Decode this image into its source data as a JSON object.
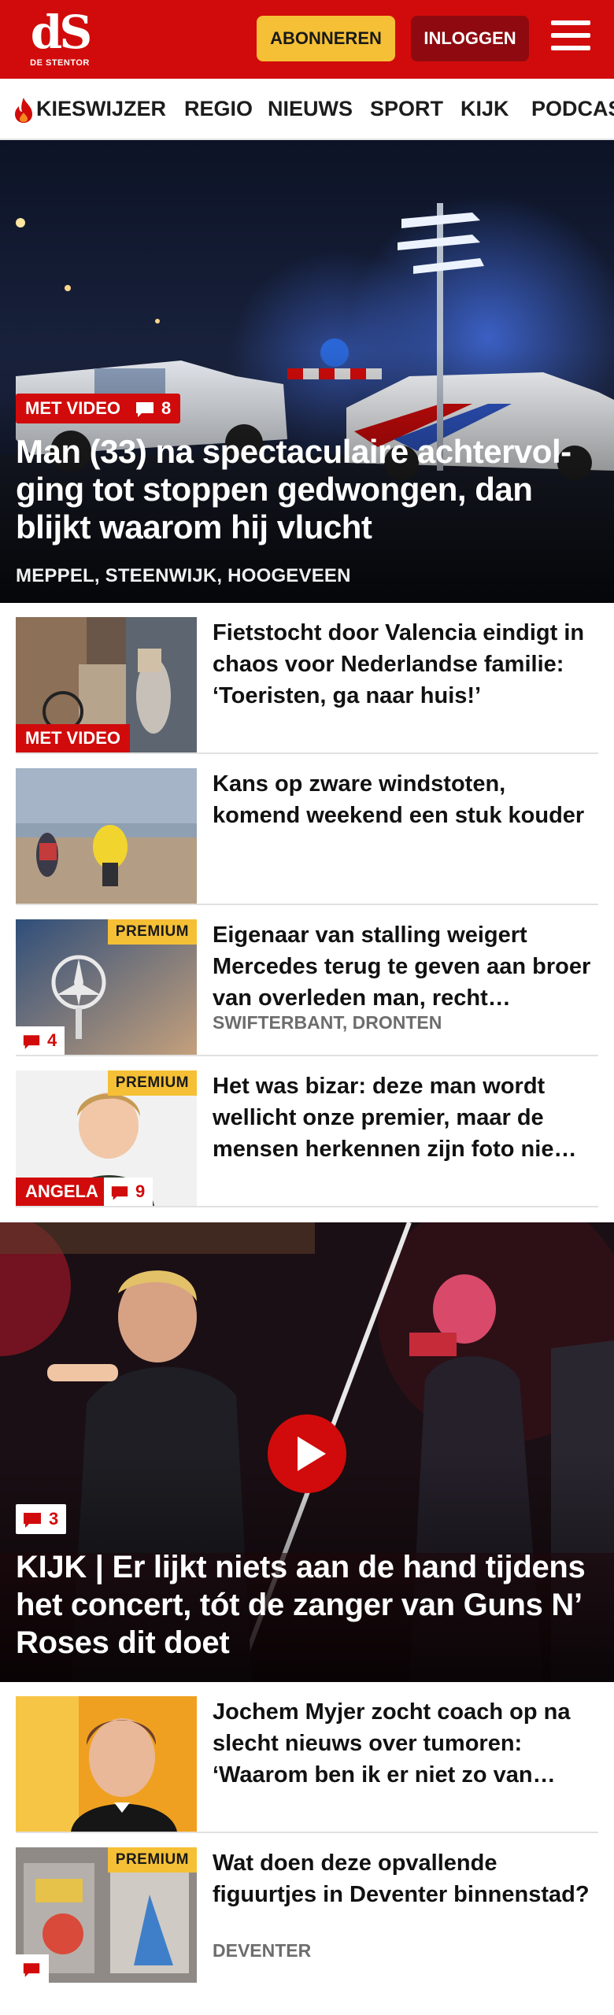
{
  "header": {
    "logo_mark": "dS",
    "logo_sub": "DE STENTOR",
    "subscribe_label": "ABONNEREN",
    "login_label": "INLOGGEN",
    "brand_red": "#d10b0b",
    "subscribe_yellow": "#f5c035"
  },
  "nav": {
    "items": [
      {
        "label": "KIESWIJZER",
        "icon": "flame-icon"
      },
      {
        "label": "REGIO"
      },
      {
        "label": "NIEUWS"
      },
      {
        "label": "SPORT"
      },
      {
        "label": "KIJK"
      },
      {
        "label": "PODCAS"
      }
    ]
  },
  "hero": {
    "badge": "MET VIDEO",
    "comments": "8",
    "title": "Man (33) na spectaculaire achtervol-ging tot stoppen gedwongen, dan blijkt waarom hij vlucht",
    "location": "MEPPEL, STEENWIJK, HOOGEVEEN"
  },
  "articles": [
    {
      "title": "Fietstocht door Valencia eindigt in chaos voor Nederlandse familie: ‘Toeristen, ga naar huis!’",
      "badge": "MET VIDEO"
    },
    {
      "title": "Kans op zware windstoten, komend weekend een stuk kouder"
    },
    {
      "title": "Eigenaar van stalling weigert Mercedes terug te geven aan broer van overleden man, recht…",
      "premium": "PREMIUM",
      "comments": "4",
      "location": "SWIFTERBANT, DRONTEN"
    },
    {
      "title": "Het was bizar: deze man wordt wellicht onze premier, maar de mensen herkennen zijn foto nie…",
      "premium": "PREMIUM",
      "tag": "ANGELA",
      "comments": "9"
    }
  ],
  "video": {
    "comments": "3",
    "title": "KIJK | Er lijkt niets aan de hand tijdens het concert, tót de zanger van Guns N’ Roses dit doet"
  },
  "articles2": [
    {
      "title": "Jochem Myjer zocht coach op na slecht nieuws over tumoren: ‘Waarom ben ik er niet zo van…"
    },
    {
      "title": "Wat doen deze opvallende figuurtjes in Deventer binnenstad?",
      "premium": "PREMIUM",
      "location": "DEVENTER"
    }
  ]
}
